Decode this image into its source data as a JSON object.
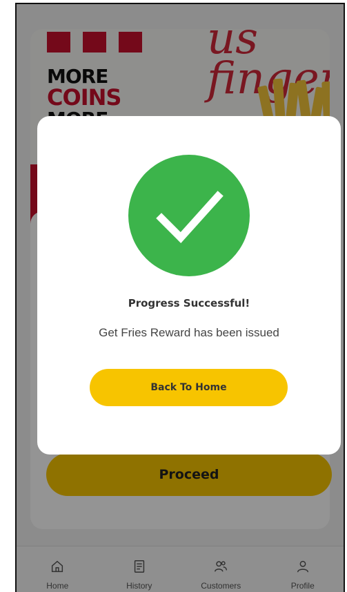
{
  "banner": {
    "line1": "MORE",
    "line2": "COINS",
    "line3": "MORE",
    "script_text": "us\nfinger"
  },
  "main": {
    "proceed_label": "Proceed"
  },
  "modal": {
    "title": "Progress Successful!",
    "message": "Get Fries Reward has been issued",
    "button_label": "Back To Home",
    "icon": "check-icon"
  },
  "nav": {
    "items": [
      {
        "label": "Home",
        "icon": "home-icon"
      },
      {
        "label": "History",
        "icon": "receipt-icon"
      },
      {
        "label": "Customers",
        "icon": "users-icon"
      },
      {
        "label": "Profile",
        "icon": "user-icon"
      }
    ]
  },
  "colors": {
    "accent": "#f7c400",
    "brand_red": "#c8102e",
    "success": "#3cb44b"
  }
}
